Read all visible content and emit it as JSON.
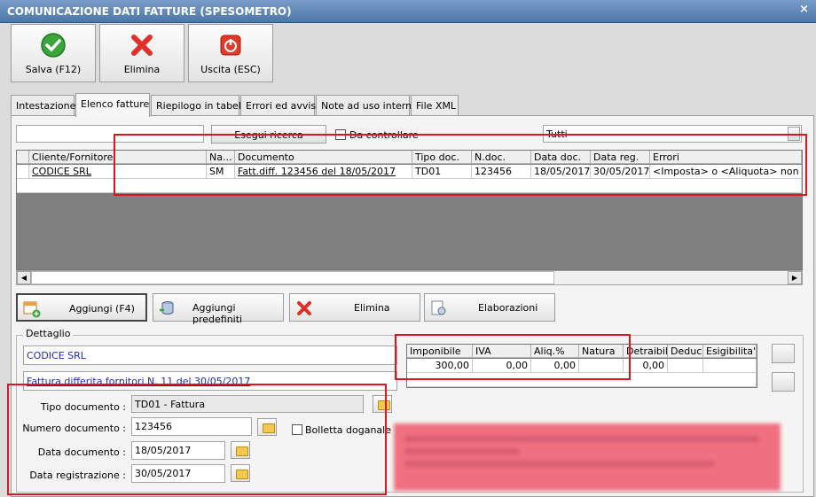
{
  "window": {
    "title": "COMUNICAZIONE DATI FATTURE (SPESOMETRO)",
    "close": "×"
  },
  "toolbar": {
    "save_label": "Salva (F12)",
    "delete_label": "Elimina",
    "exit_label": "Uscita (ESC)"
  },
  "tabs": [
    "Intestazione",
    "Elenco fatture",
    "Riepilogo in tabella",
    "Errori ed avvisi",
    "Note ad uso interno",
    "File XML"
  ],
  "filter": {
    "search_value": "",
    "search_button": "Esegui ricerca",
    "check_label": "Da controllare",
    "select_value": "Tutti"
  },
  "grid": {
    "columns": [
      "Cliente/Fornitore",
      "Na...",
      "Documento",
      "Tipo doc.",
      "N.doc.",
      "Data doc.",
      "Data reg.",
      "Errori"
    ],
    "row": [
      "CODICE SRL",
      "SM",
      "Fatt.diff. 123456 del 18/05/2017",
      "TD01",
      "123456",
      "18/05/2017",
      "30/05/2017",
      "<Imposta> o <Aliquota> non presente"
    ]
  },
  "actions": {
    "add": "Aggiungi (F4)",
    "add_predefined": "Aggiungi predefiniti",
    "delete": "Elimina",
    "process": "Elaborazioni"
  },
  "detail": {
    "group_title": "Dettaglio",
    "client": "CODICE SRL",
    "description": "Fattura differita fornitori N. 11 del 30/05/2017",
    "doc_type_label": "Tipo documento :",
    "doc_type_value": "TD01 - Fattura",
    "doc_number_label": "Numero documento :",
    "doc_number_value": "123456",
    "bolletta_label": "Bolletta doganale",
    "doc_date_label": "Data documento :",
    "doc_date_value": "18/05/2017",
    "reg_date_label": "Data registrazione :",
    "reg_date_value": "30/05/2017"
  },
  "iva_table": {
    "columns": [
      "Imponibile",
      "IVA",
      "Aliq.%",
      "Natura",
      "Detraibile",
      "Deduc.",
      "Esigibilita'"
    ],
    "row": [
      "300,00",
      "0,00",
      "0,00",
      "",
      "0,00",
      "",
      ""
    ]
  },
  "colors": {
    "highlight_border": "#e0141e",
    "title_bar": "#4c77a8",
    "link_blue": "#1b2cb0"
  }
}
